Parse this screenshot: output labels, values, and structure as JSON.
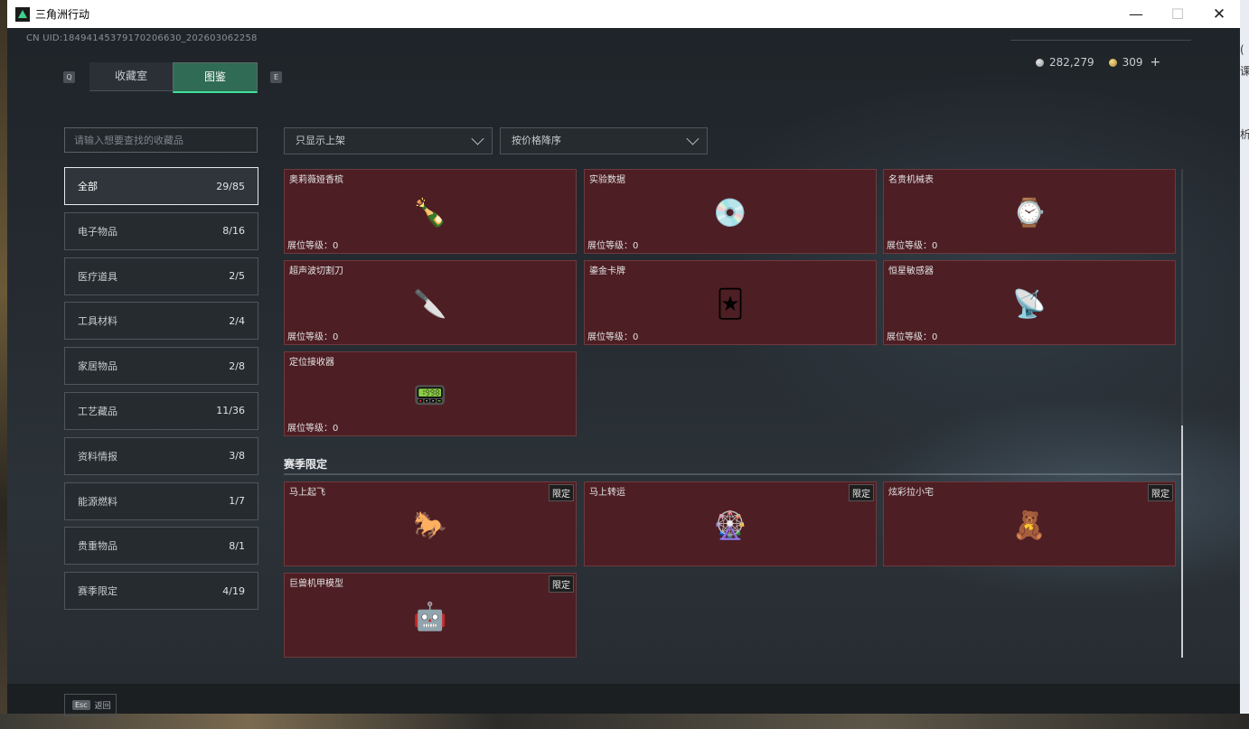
{
  "window": {
    "title": "三角洲行动"
  },
  "header": {
    "uid": "CN UID:18494145379170206630_202603062258",
    "silver": "282,279",
    "gold": "309",
    "key_left": "Q",
    "key_right": "E",
    "tabs": [
      {
        "label": "收藏室"
      },
      {
        "label": "图鉴"
      }
    ]
  },
  "sidebar": {
    "search_placeholder": "请输入想要查找的收藏品",
    "categories": [
      {
        "label": "全部",
        "count": "29/85"
      },
      {
        "label": "电子物品",
        "count": "8/16"
      },
      {
        "label": "医疗道具",
        "count": "2/5"
      },
      {
        "label": "工具材料",
        "count": "2/4"
      },
      {
        "label": "家居物品",
        "count": "2/8"
      },
      {
        "label": "工艺藏品",
        "count": "11/36"
      },
      {
        "label": "资料情报",
        "count": "3/8"
      },
      {
        "label": "能源燃料",
        "count": "1/7"
      },
      {
        "label": "贵重物品",
        "count": "8/1"
      },
      {
        "label": "赛季限定",
        "count": "4/19"
      }
    ]
  },
  "filters": {
    "shelf": "只显示上架",
    "sort": "按价格降序"
  },
  "items": [
    {
      "name": "奥莉薇娅香槟",
      "level": "展位等级：0",
      "icon": "champagne-bottle",
      "glyph": "🍾"
    },
    {
      "name": "实验数据",
      "level": "展位等级：0",
      "icon": "disc",
      "glyph": "💿"
    },
    {
      "name": "名贵机械表",
      "level": "展位等级：0",
      "icon": "gold-watch",
      "glyph": "⌚"
    },
    {
      "name": "超声波切割刀",
      "level": "展位等级：0",
      "icon": "scalpel",
      "glyph": "🔪"
    },
    {
      "name": "鎏金卡牌",
      "level": "展位等级：0",
      "icon": "gold-card",
      "glyph": "🃏"
    },
    {
      "name": "恒星敏感器",
      "level": "展位等级：0",
      "icon": "star-sensor",
      "glyph": "📡"
    },
    {
      "name": "定位接收器",
      "level": "展位等级：0",
      "icon": "gps-receiver",
      "glyph": "📟"
    }
  ],
  "season": {
    "title": "赛季限定",
    "items": [
      {
        "name": "马上起飞",
        "badge": "限定",
        "icon": "horse-figure",
        "glyph": "🐎"
      },
      {
        "name": "马上转运",
        "badge": "限定",
        "icon": "golden-wheel",
        "glyph": "🎡"
      },
      {
        "name": "炫彩拉小宅",
        "badge": "限定",
        "icon": "doll-figure",
        "glyph": "🧸"
      },
      {
        "name": "巨兽机甲模型",
        "badge": "限定",
        "icon": "mech-model",
        "glyph": "🤖"
      }
    ]
  },
  "footer": {
    "esc_key": "Esc",
    "esc_label": "返回"
  }
}
